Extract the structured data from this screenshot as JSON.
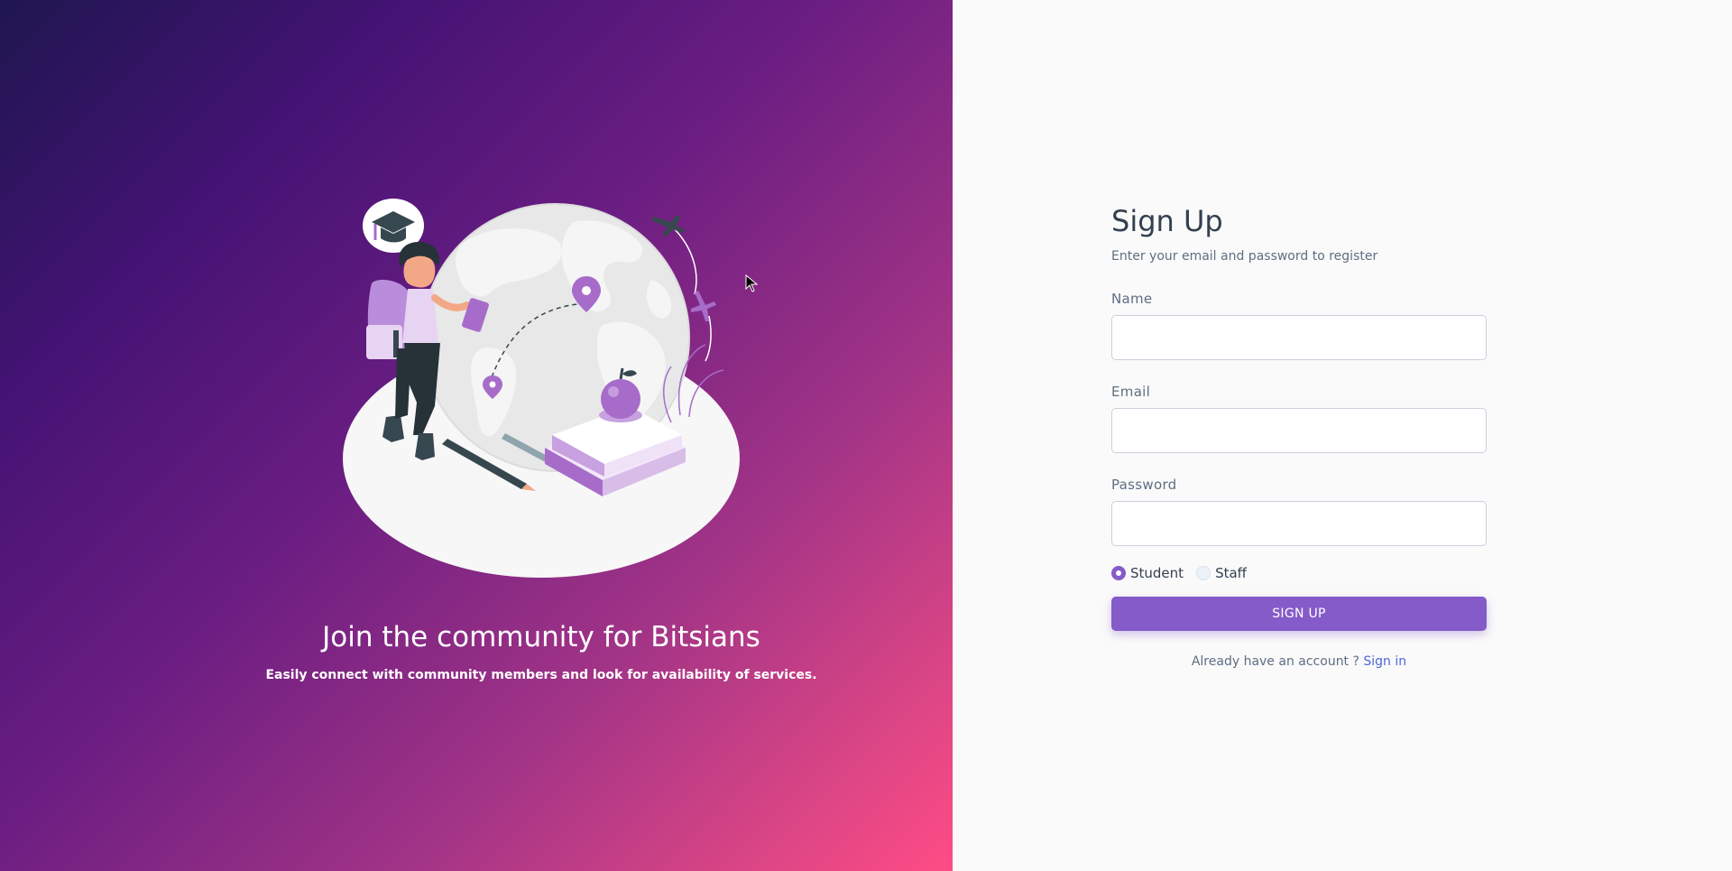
{
  "hero": {
    "title": "Join the community for Bitsians",
    "subtitle": "Easily connect with community members and look for availability of services."
  },
  "form": {
    "title": "Sign Up",
    "subtitle": "Enter your email and password to register",
    "fields": [
      {
        "label": "Name",
        "value": "",
        "placeholder": ""
      },
      {
        "label": "Email",
        "value": "",
        "placeholder": ""
      },
      {
        "label": "Password",
        "value": "",
        "placeholder": ""
      }
    ],
    "roles": [
      {
        "label": "Student",
        "checked": true
      },
      {
        "label": "Staff",
        "checked": false
      }
    ],
    "submit_label": "SIGN UP",
    "footer_text": "Already have an account ? ",
    "footer_link": "Sign in"
  },
  "colors": {
    "accent": "#845bc8",
    "link": "#4f66d9",
    "gradient_start": "#1f1650",
    "gradient_end": "#ff4c85"
  },
  "icons": [
    "graduation-cap-icon",
    "location-pin-icon",
    "airplane-icon",
    "apple-icon",
    "mouse-cursor-icon"
  ]
}
